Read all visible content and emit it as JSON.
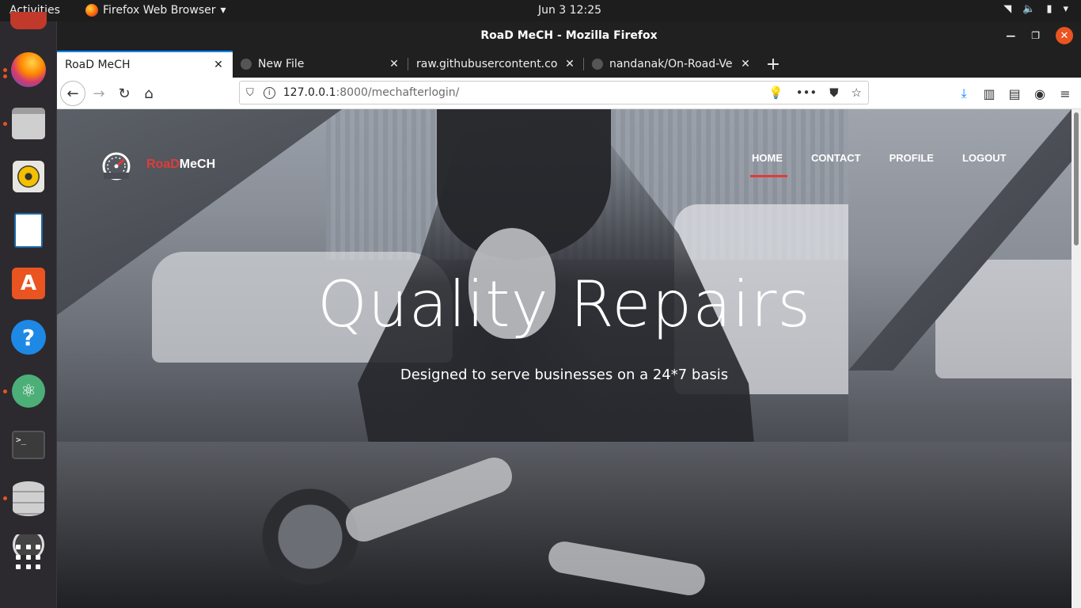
{
  "topbar": {
    "activities": "Activities",
    "app_name": "Firefox Web Browser",
    "clock": "Jun 3  12:25"
  },
  "window": {
    "title": "RoaD MeCH - Mozilla Firefox"
  },
  "tabs": [
    {
      "label": "RoaD MeCH"
    },
    {
      "label": "New File"
    },
    {
      "label": "raw.githubusercontent.com"
    },
    {
      "label": "nandanak/On-Road-Vehi"
    }
  ],
  "urlbar": {
    "host": "127.0.0.1",
    "path": ":8000/mechafterlogin/"
  },
  "site": {
    "brand_red": "RoaD",
    "brand_white": "MeCH",
    "nav": [
      {
        "label": "HOME"
      },
      {
        "label": "CONTACT"
      },
      {
        "label": "PROFILE"
      },
      {
        "label": "LOGOUT"
      }
    ],
    "headline": "Quality Repairs",
    "tagline": "Designed to serve businesses on a 24*7 basis"
  },
  "dock": {
    "icons": [
      "firefox-icon",
      "files-icon",
      "rhythmbox-icon",
      "writer-icon",
      "software-icon",
      "help-icon",
      "atom-icon",
      "terminal-icon",
      "database-icon",
      "show-apps-icon"
    ]
  },
  "colors": {
    "accent_red": "#e23b3b",
    "ubuntu_orange": "#e95420",
    "firefox_blue": "#0a84ff"
  }
}
